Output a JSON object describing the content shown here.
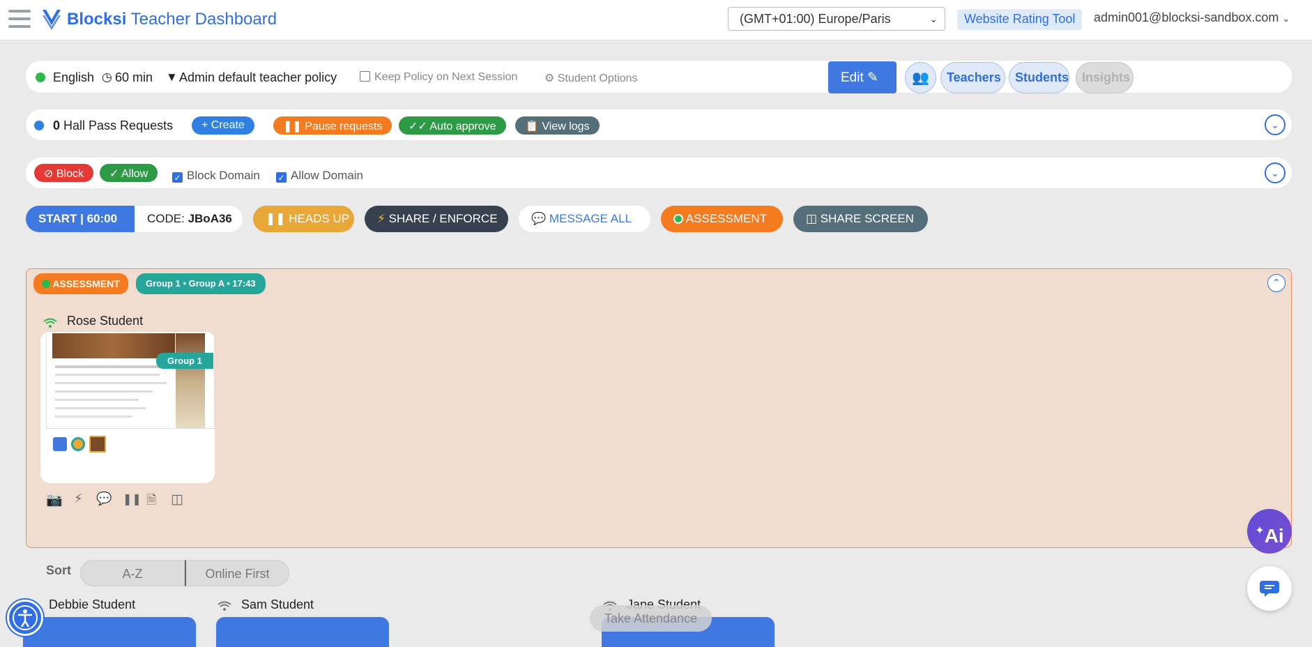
{
  "header": {
    "brand_bold": "Blocksi",
    "brand_rest": "Teacher Dashboard",
    "timezone": "(GMT+01:00) Europe/Paris",
    "rating_tool": "Website Rating Tool",
    "account": "admin001@blocksi-sandbox.com"
  },
  "session": {
    "language": "English",
    "duration": "60 min",
    "policy": "Admin default teacher policy",
    "keep_policy": "Keep Policy on Next Session",
    "student_options": "Student Options",
    "edit_label": "Edit",
    "tabs": [
      "Teachers",
      "Students",
      "Insights"
    ]
  },
  "hall_pass": {
    "count": "0",
    "label": "Hall Pass Requests",
    "create": "Create",
    "pause": "Pause requests",
    "auto": "Auto approve",
    "logs": "View logs"
  },
  "filters": {
    "block": "Block",
    "allow": "Allow",
    "block_domain": "Block Domain",
    "allow_domain": "Allow Domain"
  },
  "actions": {
    "start": "START | 60:00",
    "code_label": "CODE:",
    "code_value": "JBoA36",
    "heads_up": "HEADS UP",
    "share_enforce": "SHARE / ENFORCE",
    "message_all": "MESSAGE ALL",
    "assessment": "ASSESSMENT",
    "share_screen": "SHARE SCREEN"
  },
  "assessment_group": {
    "badge": "ASSESSMENT",
    "group_info": "Group 1 • Group A •  17:43",
    "student": "Rose Student",
    "group_tag": "Group 1",
    "ai_label": "Ai"
  },
  "sort": {
    "label": "Sort",
    "options": [
      "A-Z",
      "Online First"
    ]
  },
  "students": [
    "Debbie Student",
    "Sam Student",
    "Jane Student"
  ],
  "take_attendance": "Take Attendance",
  "colors": {
    "accent": "#3f78e0",
    "orange": "#f47b20",
    "green": "#2e9a46",
    "red": "#e53935",
    "teal": "#26a69a",
    "slate": "#546e7a",
    "dark": "#37404f",
    "gold": "#e8a838"
  }
}
